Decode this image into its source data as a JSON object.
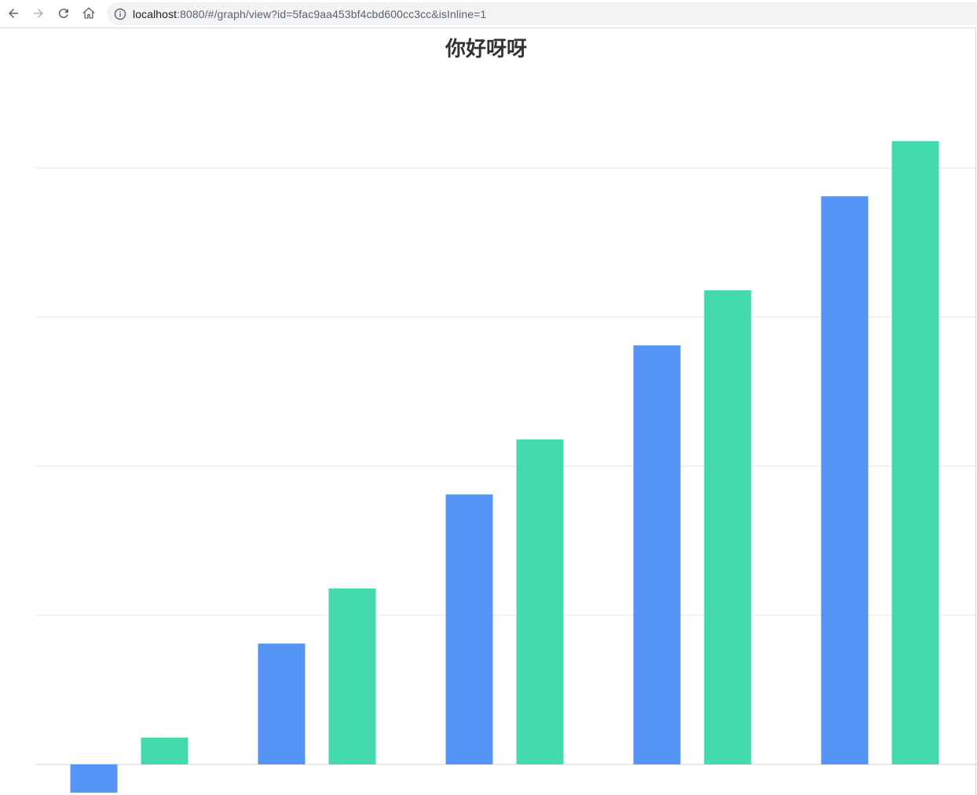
{
  "browser": {
    "url_host": "localhost",
    "url_rest": ":8080/#/graph/view?id=5fac9aa453bf4cbd600cc3cc&isInline=1",
    "icons": [
      "back-arrow-icon",
      "forward-arrow-icon",
      "reload-icon",
      "home-icon",
      "info-icon"
    ]
  },
  "chart_data": {
    "type": "bar",
    "title": "你好呀呀",
    "xlabel": "",
    "ylabel": "",
    "categories": [
      "",
      "",
      "",
      "",
      ""
    ],
    "series": [
      {
        "color": "#5694f5",
        "values": [
          -0.19,
          0.81,
          1.81,
          2.81,
          3.81
        ]
      },
      {
        "color": "#43dbab",
        "values": [
          0.18,
          1.18,
          2.18,
          3.18,
          4.18
        ]
      }
    ],
    "ylim": [
      -0.2,
      4.0
    ],
    "grid": true,
    "axis_labels_visible": false,
    "legend": "none"
  }
}
